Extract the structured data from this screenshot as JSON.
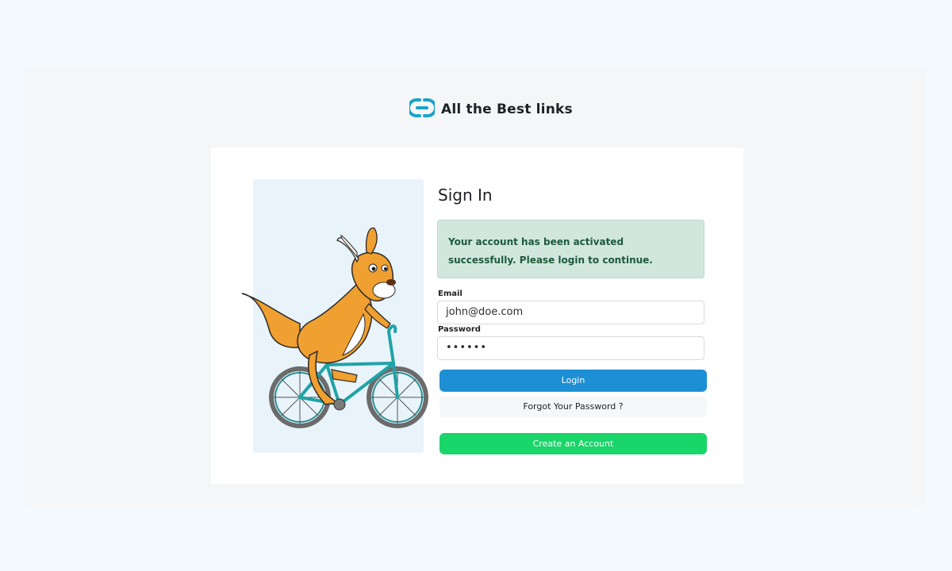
{
  "brand": {
    "name": "All the Best links",
    "logo_icon": "chain-link-icon",
    "logo_color": "#19a3c8"
  },
  "signin": {
    "title": "Sign In",
    "alert": "Your account has been activated successfully. Please login to continue.",
    "email_label": "Email",
    "email_value": "john@doe.com",
    "password_label": "Password",
    "password_value": "••••••",
    "login_label": "Login",
    "forgot_label": "Forgot Your Password ?",
    "create_label": "Create an Account"
  },
  "illustration": {
    "subject": "kangaroo-riding-bicycle"
  },
  "colors": {
    "primary": "#1d8fd4",
    "success_button": "#1ad56a",
    "alert_bg": "#d1e7dd",
    "alert_text": "#1d5a3c"
  }
}
